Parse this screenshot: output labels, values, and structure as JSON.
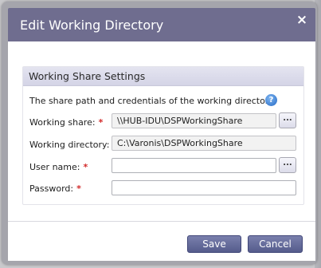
{
  "dialog": {
    "title": "Edit Working Directory",
    "close_glyph": "×"
  },
  "section": {
    "legend": "Working Share Settings",
    "description": "The share path and credentials of the working directory",
    "help_glyph": "?"
  },
  "fields": {
    "working_share": {
      "label": "Working share:",
      "required_mark": "*",
      "value": "\\\\HUB-IDU\\DSPWorkingShare",
      "browse_label": "..."
    },
    "working_directory": {
      "label": "Working directory:",
      "value": "C:\\Varonis\\DSPWorkingShare"
    },
    "user_name": {
      "label": "User name:",
      "required_mark": "*",
      "value": "",
      "browse_label": "..."
    },
    "password": {
      "label": "Password:",
      "required_mark": "*",
      "value": ""
    }
  },
  "footer": {
    "save_label": "Save",
    "cancel_label": "Cancel"
  },
  "colors": {
    "title_bar": "#6f6d8f",
    "button": "#555c8c",
    "required": "#d22a2a",
    "help_icon": "#2469c4"
  },
  "icons": {
    "close": "close-icon",
    "help": "help-icon"
  }
}
